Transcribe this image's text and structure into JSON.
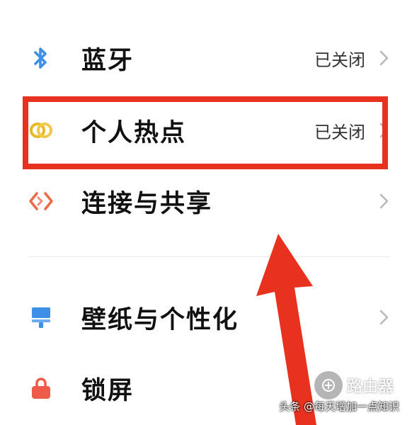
{
  "settings": {
    "items": [
      {
        "label": "蓝牙",
        "status": "已关闭",
        "icon": "bluetooth-icon"
      },
      {
        "label": "个人热点",
        "status": "已关闭",
        "icon": "hotspot-icon"
      },
      {
        "label": "连接与共享",
        "status": "",
        "icon": "connection-share-icon"
      },
      {
        "label": "壁纸与个性化",
        "status": "",
        "icon": "wallpaper-icon"
      },
      {
        "label": "锁屏",
        "status": "",
        "icon": "lock-icon"
      }
    ]
  },
  "colors": {
    "highlight": "#e8321f",
    "bluetooth": "#3d8fe8",
    "hotspot": "#e8b923",
    "connection": "#ee6a4a",
    "wallpaper": "#3d8fe8",
    "lock": "#ef5a4a"
  },
  "watermark": {
    "badge_text": "路由器",
    "credit": "头条 @每天增加一点知识"
  }
}
